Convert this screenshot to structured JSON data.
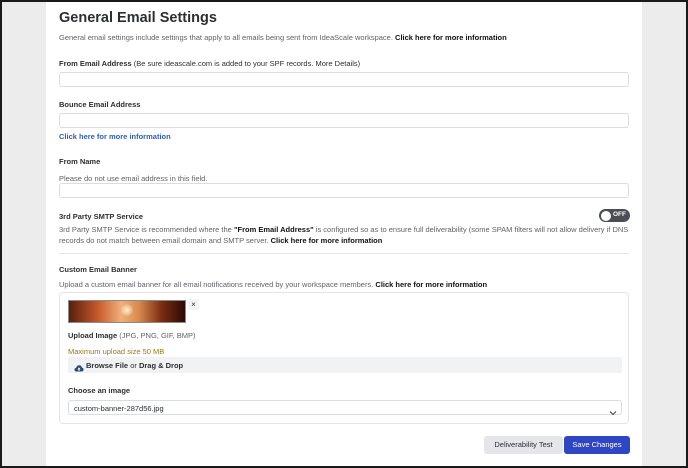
{
  "page": {
    "title": "General Email Settings",
    "description": "General email settings include settings that apply to all emails being sent from IdeaScale workspace.",
    "description_link": "Click here for more information"
  },
  "from_email": {
    "label": "From Email Address",
    "note_open": " (Be sure ideascale.com is added to your SPF records. ",
    "note_link": "More Details",
    "note_close": ")",
    "value": ""
  },
  "bounce_email": {
    "label": "Bounce Email Address",
    "value": "",
    "link": "Click here for more information"
  },
  "from_name": {
    "label": "From Name",
    "hint": "Please do not use email address in this field.",
    "value": ""
  },
  "smtp": {
    "label": "3rd Party SMTP Service",
    "line1_pre": "3rd Party SMTP Service is recommended where the ",
    "line1_bold": "\"From Email Address\"",
    "line1_post": " is configured so as to ensure full deliverability (some SPAM filters will not allow delivery if DNS",
    "line2_pre": "records do not match between email domain and SMTP server. ",
    "line2_link": "Click here for more information",
    "toggle_label": "OFF"
  },
  "banner": {
    "label": "Custom Email Banner",
    "description": "Upload a custom email banner for all email notifications received by your workspace members.",
    "description_link": "Click here for more information",
    "remove_symbol": "×",
    "upload_label": "Upload Image",
    "upload_formats": " (JPG, PNG, GIF, BMP)",
    "max_size": "Maximum upload size 50 MB",
    "browse_bold1": "Browse File",
    "browse_or": " or ",
    "browse_bold2": "Drag & Drop",
    "choose_label": "Choose an image",
    "selected_image": "custom-banner-287d56.jpg"
  },
  "actions": {
    "test_label": "Deliverability Test",
    "save_label": "Save Changes"
  },
  "colors": {
    "link": "#2c5fb8",
    "primary_button": "#2f46c4",
    "max_size_text": "#9a7a1a"
  }
}
